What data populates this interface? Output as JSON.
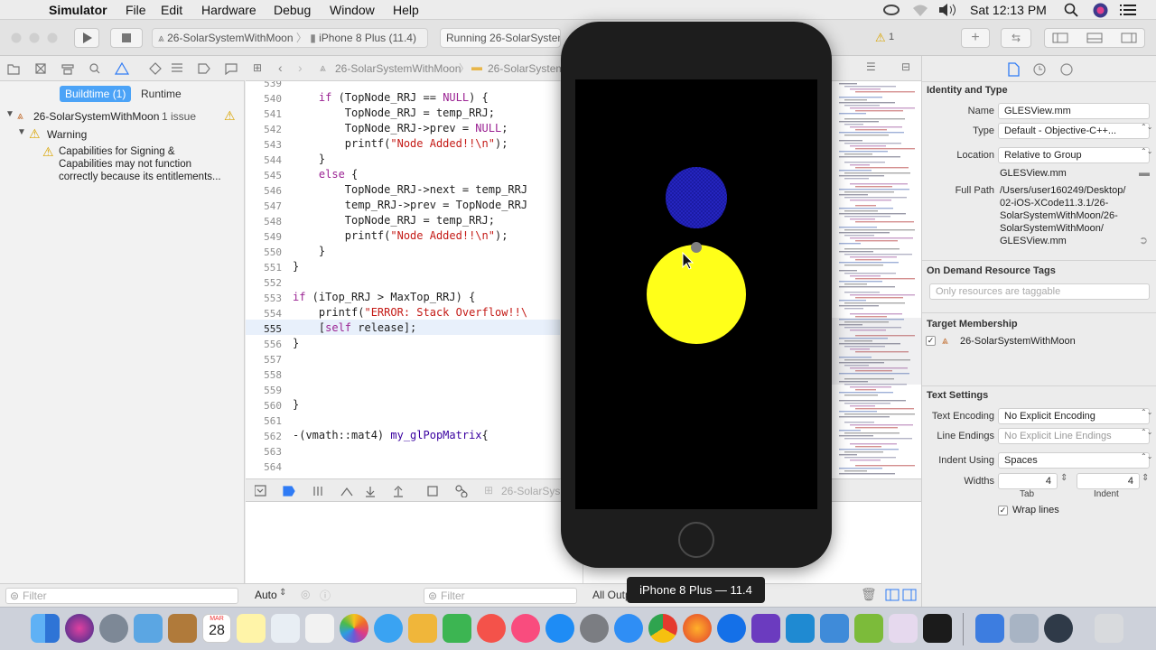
{
  "menubar": {
    "app_name": "Simulator",
    "items": [
      "File",
      "Edit",
      "Hardware",
      "Debug",
      "Window",
      "Help"
    ],
    "clock": "Sat 12:13 PM"
  },
  "toolbar": {
    "scheme_project": "26-SolarSystemWithMoon",
    "scheme_device": "iPhone 8 Plus (11.4)",
    "status": "Running 26-SolarSystem",
    "warning_count": "1"
  },
  "navigator": {
    "tabs": [
      "Buildtime (1)",
      "Runtime"
    ],
    "project": "26-SolarSystemWithMoon",
    "issue_count": "1 issue",
    "group": "Warning",
    "warning_text": [
      "Capabilities for Signing &",
      "Capabilities may not function",
      "correctly because its entitlements..."
    ],
    "filter_placeholder": "Filter"
  },
  "jumpbar": {
    "project": "26-SolarSystemWithMoon",
    "folder": "26-SolarSystem"
  },
  "editor": {
    "lines": [
      {
        "n": "539",
        "code": ""
      },
      {
        "n": "540",
        "code": "    if (TopNode_RRJ == NULL) {"
      },
      {
        "n": "541",
        "code": "        TopNode_RRJ = temp_RRJ;"
      },
      {
        "n": "542",
        "code": "        TopNode_RRJ->prev = NULL;"
      },
      {
        "n": "543",
        "code": "        printf(\"Node Added!!\\n\");"
      },
      {
        "n": "544",
        "code": "    }"
      },
      {
        "n": "545",
        "code": "    else {"
      },
      {
        "n": "546",
        "code": "        TopNode_RRJ->next = temp_RRJ"
      },
      {
        "n": "547",
        "code": "        temp_RRJ->prev = TopNode_RRJ"
      },
      {
        "n": "548",
        "code": "        TopNode_RRJ = temp_RRJ;"
      },
      {
        "n": "549",
        "code": "        printf(\"Node Added!!\\n\");"
      },
      {
        "n": "550",
        "code": "    }"
      },
      {
        "n": "551",
        "code": "}"
      },
      {
        "n": "552",
        "code": ""
      },
      {
        "n": "553",
        "code": "if (iTop_RRJ > MaxTop_RRJ) {"
      },
      {
        "n": "554",
        "code": "    printf(\"ERROR: Stack Overflow!!\\"
      },
      {
        "n": "555",
        "code": "    [self release];"
      },
      {
        "n": "556",
        "code": "}"
      },
      {
        "n": "557",
        "code": ""
      },
      {
        "n": "558",
        "code": ""
      },
      {
        "n": "559",
        "code": ""
      },
      {
        "n": "560",
        "code": "}"
      },
      {
        "n": "561",
        "code": ""
      },
      {
        "n": "562",
        "code": "-(vmath::mat4) my_glPopMatrix{"
      },
      {
        "n": "563",
        "code": ""
      },
      {
        "n": "564",
        "code": ""
      }
    ]
  },
  "debugbar": {
    "target": "26-SolarSys"
  },
  "bottombar": {
    "auto_label": "Auto",
    "filter_placeholder": "Filter",
    "output_label": "All Outp"
  },
  "inspector": {
    "section_identity": "Identity and Type",
    "name_label": "Name",
    "name_value": "GLESView.mm",
    "type_label": "Type",
    "type_value": "Default - Objective-C++...",
    "location_label": "Location",
    "location_value": "Relative to Group",
    "location_file": "GLESView.mm",
    "fullpath_label": "Full Path",
    "fullpath_lines": [
      "/Users/user160249/Desktop/",
      "02-iOS-XCode11.3.1/26-",
      "SolarSystemWithMoon/26-",
      "SolarSystemWithMoon/",
      "GLESView.mm"
    ],
    "section_odr": "On Demand Resource Tags",
    "odr_placeholder": "Only resources are taggable",
    "section_target": "Target Membership",
    "target_name": "26-SolarSystemWithMoon",
    "section_text": "Text Settings",
    "encoding_label": "Text Encoding",
    "encoding_value": "No Explicit Encoding",
    "line_endings_label": "Line Endings",
    "line_endings_value": "No Explicit Line Endings",
    "indent_using_label": "Indent Using",
    "indent_using_value": "Spaces",
    "widths_label": "Widths",
    "tab_value": "4",
    "indent_value": "4",
    "tab_label": "Tab",
    "indent_label": "Indent",
    "wrap_label": "Wrap lines"
  },
  "simulator": {
    "device_label": "iPhone 8 Plus — 11.4",
    "earth_color": "#1a1aa0",
    "sun_color": "#ffff19",
    "moon_color": "#808080"
  },
  "dock": {
    "date_month": "MAR",
    "date_day": "28"
  }
}
